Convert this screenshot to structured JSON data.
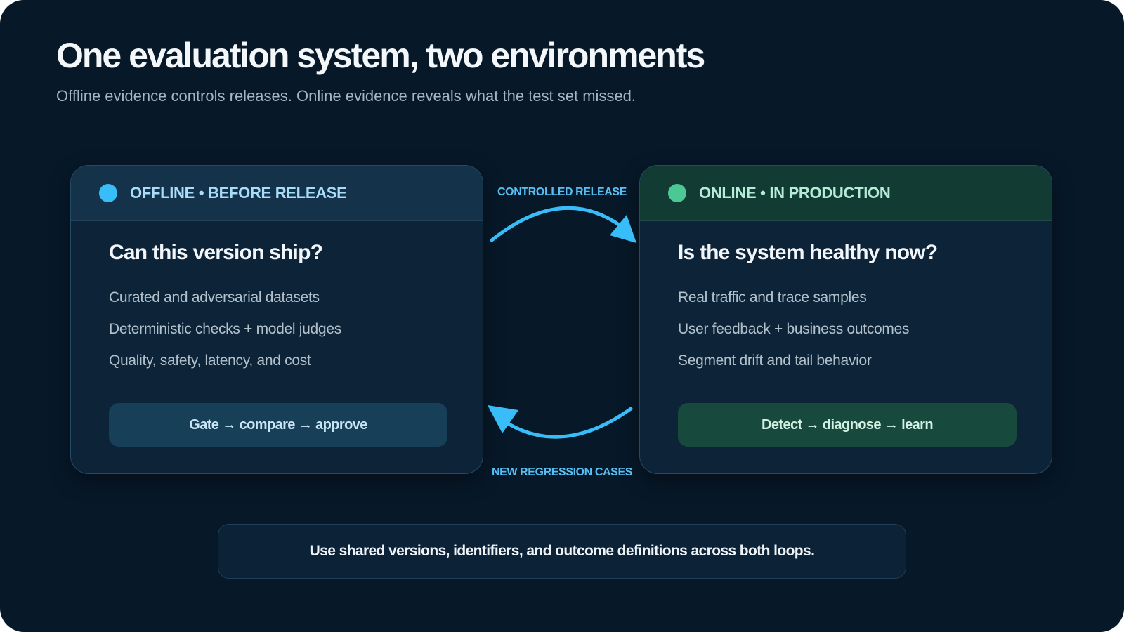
{
  "header": {
    "title": "One evaluation system, two environments",
    "subtitle": "Offline evidence controls releases. Online evidence reveals what the test set missed."
  },
  "offline": {
    "label": "OFFLINE • BEFORE RELEASE",
    "question": "Can this version ship?",
    "items": [
      "Curated and adversarial datasets",
      "Deterministic checks + model judges",
      "Quality, safety, latency, and cost"
    ],
    "action": "Gate → compare → approve",
    "color": "#38bdf8"
  },
  "online": {
    "label": "ONLINE • IN PRODUCTION",
    "question": "Is the system healthy now?",
    "items": [
      "Real traffic and trace samples",
      "User feedback + business outcomes",
      "Segment drift and tail behavior"
    ],
    "action": "Detect → diagnose → learn",
    "color": "#4cc894"
  },
  "flows": {
    "forward": "CONTROLLED RELEASE",
    "backward": "NEW REGRESSION CASES",
    "arrow_color": "#38bdf8"
  },
  "footer": {
    "text": "Use shared versions, identifiers, and outcome definitions across both loops."
  }
}
